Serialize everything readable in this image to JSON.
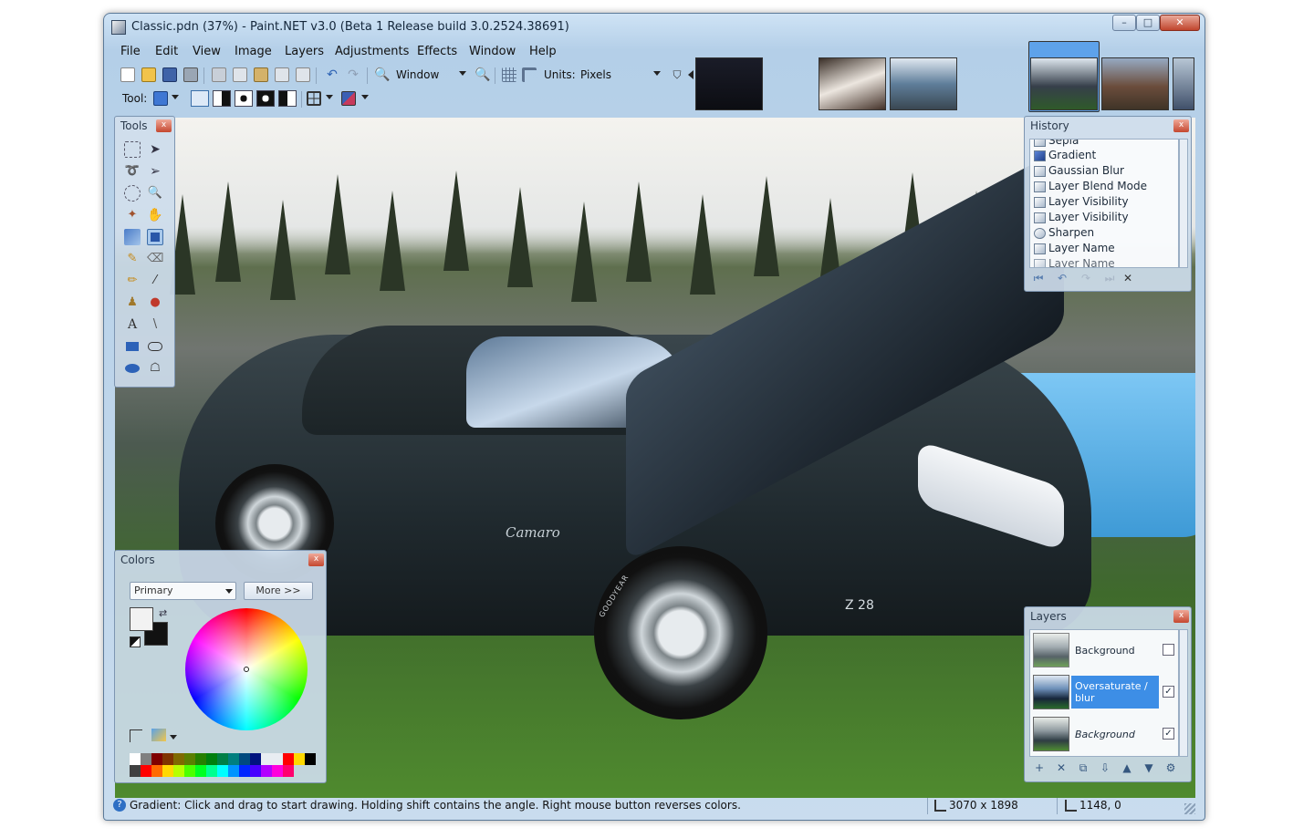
{
  "window": {
    "title": "Classic.pdn (37%) - Paint.NET v3.0 (Beta 1 Release build 3.0.2524.38691)",
    "controls": [
      "–",
      "□",
      "✕"
    ]
  },
  "menu": [
    "File",
    "Edit",
    "View",
    "Image",
    "Layers",
    "Adjustments",
    "Effects",
    "Window",
    "Help"
  ],
  "toolbar": {
    "zoom_value": "Window",
    "units_label": "Units:",
    "units_value": "Pixels",
    "tool_label": "Tool:"
  },
  "canvas": {
    "car_script": "Camaro",
    "car_badge": "Z 28",
    "tire_text": "GOODYEAR"
  },
  "panels": {
    "tools": {
      "title": "Tools",
      "close": "x"
    },
    "history": {
      "title": "History",
      "close": "x",
      "items": [
        "Sepia",
        "Gradient",
        "Gaussian Blur",
        "Layer Blend Mode",
        "Layer Visibility",
        "Layer Visibility",
        "Sharpen",
        "Layer Name",
        "Layer Name"
      ],
      "controls": [
        "⏮",
        "↶",
        "↷",
        "⏭",
        "✕"
      ]
    },
    "colors": {
      "title": "Colors",
      "close": "x",
      "mode": "Primary",
      "more_label": "More >>"
    },
    "layers": {
      "title": "Layers",
      "close": "x",
      "items": [
        {
          "name": "Background",
          "checked": "",
          "selected": false
        },
        {
          "name": "Oversaturate / blur",
          "checked": "✓",
          "selected": true
        },
        {
          "name": "Background",
          "checked": "✓",
          "selected": false
        }
      ],
      "controls": [
        "+",
        "✕",
        "⧉",
        "⇩",
        "▲",
        "▼",
        "⚙"
      ]
    }
  },
  "status": {
    "message": "Gradient: Click and drag to start drawing. Holding shift contains the angle. Right mouse button reverses colors.",
    "image_size": "3070 x 1898",
    "cursor_pos": "1148, 0"
  },
  "colors": {
    "primary": "#f2f2f2",
    "secondary": "#111111",
    "accent": "#3d8ee6"
  }
}
